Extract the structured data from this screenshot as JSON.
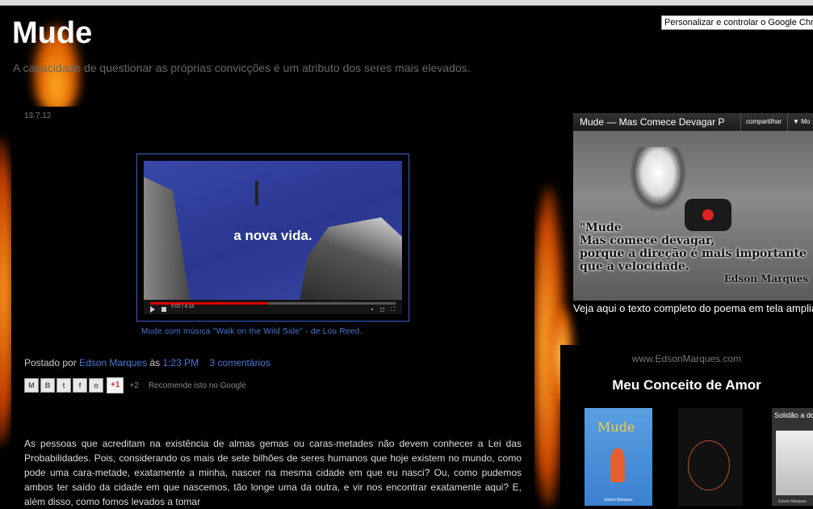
{
  "browser": {
    "tooltip": "Personalizar e controlar o Google Chrome"
  },
  "header": {
    "title": "Mude",
    "description": "A capacidade de questionar as próprias convicções é um atributo dos seres mais elevados."
  },
  "post": {
    "date": "13.7.12",
    "video": {
      "caption": "a nova vida.",
      "time": "0:00 / 4:18",
      "progress_fraction": 0.48
    },
    "video_link": "Mude com música \"Walk on the Wild Side\" - de Lou Reed.",
    "footer": {
      "posted_by": "Postado por",
      "author": "Edson Marques",
      "at": "às",
      "time": "1:23 PM",
      "comments": "3 comentários"
    },
    "share": {
      "buttons": [
        {
          "icon": "email-icon",
          "glyph": "M"
        },
        {
          "icon": "blogger-icon",
          "glyph": "B"
        },
        {
          "icon": "twitter-icon",
          "glyph": "t"
        },
        {
          "icon": "facebook-icon",
          "glyph": "f"
        },
        {
          "icon": "orkut-icon",
          "glyph": "o"
        }
      ],
      "gplus_label": "+1",
      "gplus_count": "+2",
      "recommend": "Recomende isto no Google"
    },
    "body": "As pessoas que acreditam na existência de almas gemas ou caras-metades não devem conhecer a Lei das Probabilidades. Pois, considerando os mais de sete bilhões de seres humanos que hoje existem no mundo, como pode uma cara-metade, exatamente a minha, nascer na mesma cidade em que eu nasci? Ou, como pudemos ambos ter saído da cidade em que nascemos, tão longe uma da outra, e vir nos encontrar exatamente aqui? E, além disso, como fomos levados a tomar"
  },
  "sidebar": {
    "youtube": {
      "title": "Mude — Mas Comece Devagar P",
      "share_label": "compartilhar",
      "more_label": "Mo",
      "quote_lines": [
        "\"Mude",
        "Mas comece devagar,",
        "porque a direção é mais importante",
        "que a velocidade."
      ],
      "quote_author": "Edson Marques"
    },
    "note": "Veja aqui o texto completo do poema em tela ampliada",
    "site_url": "www.EdsonMarques.com",
    "widget_title": "Meu Conceito de Amor",
    "books": {
      "book1_title": "Mude",
      "book1_author": "Edson Marques",
      "book3_title": "Solidão a dois",
      "book3_author": "Edson Marques"
    }
  }
}
